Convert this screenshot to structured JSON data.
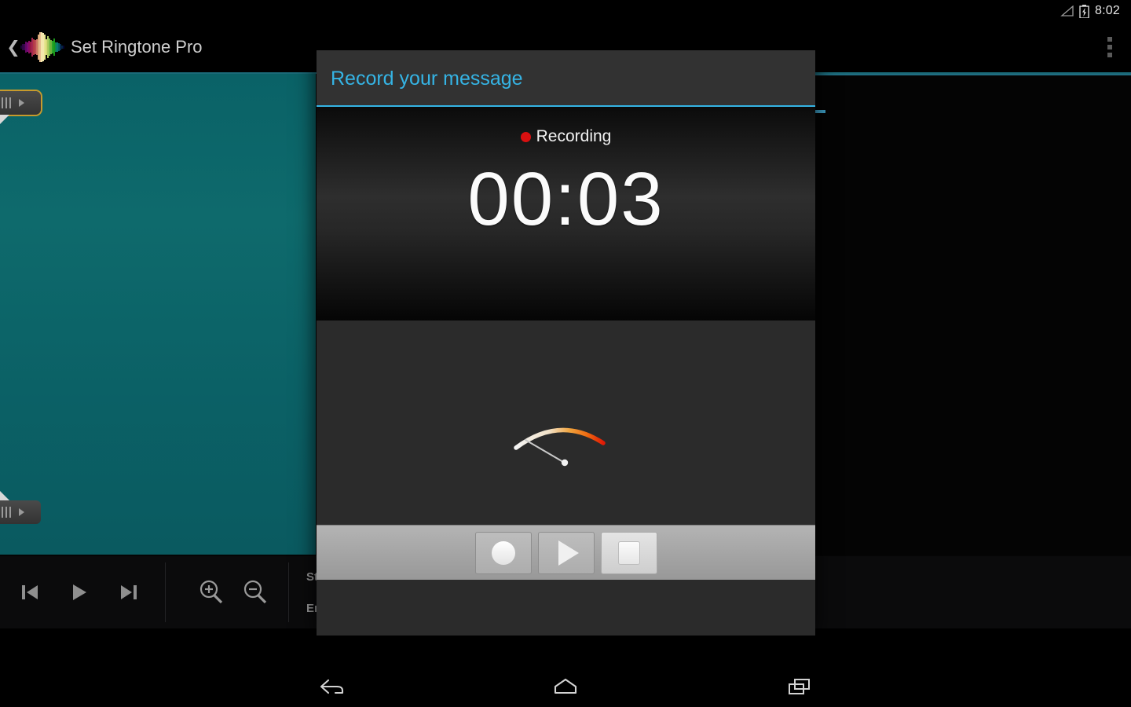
{
  "status_bar": {
    "time": "8:02",
    "signal_icon": "signal-triangle-icon",
    "battery_icon": "battery-charging-icon"
  },
  "action_bar": {
    "back_icon": "back-chevron-icon",
    "app_logo_icon": "waveform-logo-icon",
    "title": "Set Ringtone Pro",
    "overflow_icon": "overflow-menu-icon"
  },
  "editor": {
    "start_handle_icon": "selection-handle-start-icon",
    "end_handle_icon": "selection-handle-end-icon",
    "toolbar": {
      "rewind_icon": "skip-previous-icon",
      "play_icon": "play-icon",
      "forward_icon": "skip-next-icon",
      "zoom_in_icon": "zoom-in-icon",
      "zoom_out_icon": "zoom-out-icon",
      "start_label": "Start(s):",
      "end_label": "End(s):",
      "start_value": "",
      "end_value": ""
    }
  },
  "dialog": {
    "title": "Record your message",
    "accent_color": "#35b4e5",
    "recording_status": "Recording",
    "recording_dot_color": "#d81010",
    "timer": "00:03",
    "meter_icon": "vu-meter-icon",
    "buttons": [
      {
        "name": "record-button",
        "icon": "record-circle-icon",
        "highlighted": false
      },
      {
        "name": "play-button",
        "icon": "play-triangle-icon",
        "highlighted": false
      },
      {
        "name": "stop-button",
        "icon": "stop-square-icon",
        "highlighted": true
      }
    ]
  },
  "nav_bar": {
    "back_icon": "nav-back-icon",
    "home_icon": "nav-home-icon",
    "recents_icon": "nav-recents-icon"
  }
}
